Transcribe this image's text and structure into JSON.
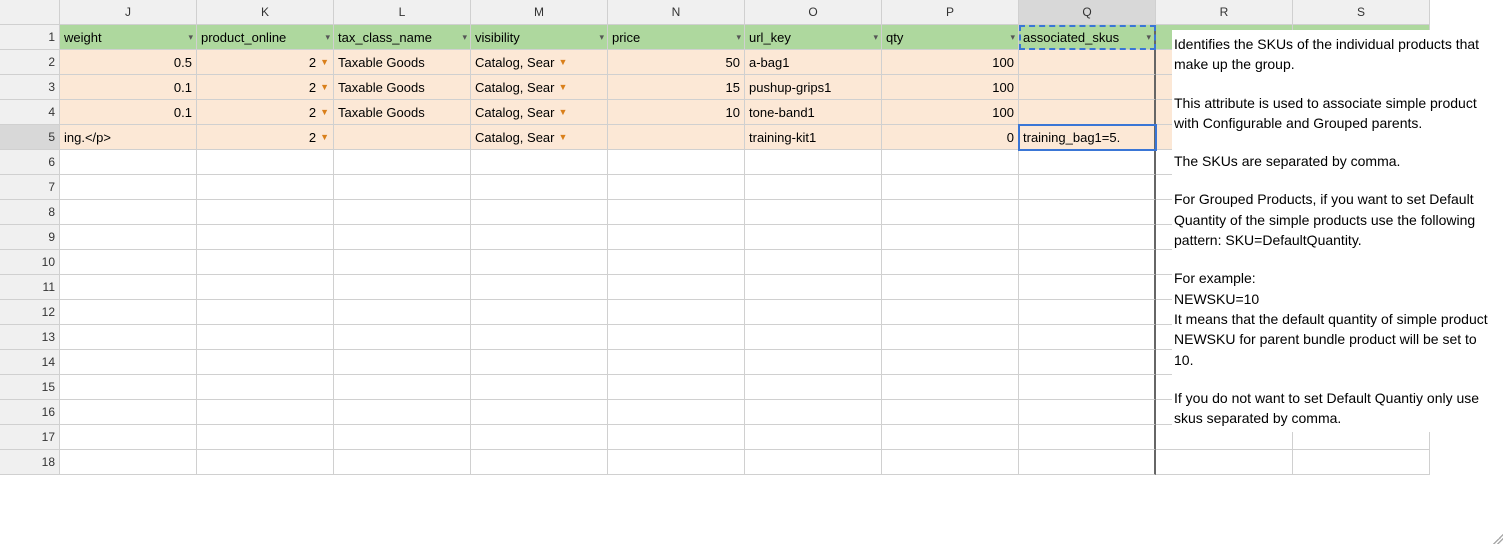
{
  "columns": [
    "J",
    "K",
    "L",
    "M",
    "N",
    "O",
    "P",
    "Q",
    "R",
    "S"
  ],
  "row_count": 18,
  "headers": {
    "J": "weight",
    "K": "product_online",
    "L": "tax_class_name",
    "M": "visibility",
    "N": "price",
    "O": "url_key",
    "P": "qty",
    "Q": "associated_skus",
    "R": "",
    "S": ""
  },
  "rows": [
    {
      "J": "0.5",
      "K": "2",
      "L": "Taxable Goods",
      "M": "Catalog, Sear",
      "N": "50",
      "O": "a-bag1",
      "P": "100",
      "Q": ""
    },
    {
      "J": "0.1",
      "K": "2",
      "L": "Taxable Goods",
      "M": "Catalog, Sear",
      "N": "15",
      "O": "pushup-grips1",
      "P": "100",
      "Q": ""
    },
    {
      "J": "0.1",
      "K": "2",
      "L": "Taxable Goods",
      "M": "Catalog, Sear",
      "N": "10",
      "O": "tone-band1",
      "P": "100",
      "Q": ""
    },
    {
      "J": "ing.</p>",
      "K": "2",
      "L": "",
      "M": "Catalog, Sear",
      "N": "",
      "O": "training-kit1",
      "P": "0",
      "Q": "training_bag1=5."
    }
  ],
  "dropdown_cols": [
    "K",
    "M"
  ],
  "numeric_cols": [
    "J",
    "K",
    "N",
    "P"
  ],
  "active_cell": "Q5",
  "dashed_cell": "Q1",
  "tooltip": {
    "p1": "Identifies the SKUs of the individual products that make up the group.",
    "p2": "This attribute is used to associate simple product with Configurable and Grouped parents.",
    "p3": "The SKUs are separated by comma.",
    "p4": "For Grouped Products, if you want to set Default Quantity of the simple products use the following pattern: SKU=DefaultQuantity.",
    "p5": "For example:\nNEWSKU=10\nIt means that the default quantity of simple product NEWSKU for parent bundle product will be set to 10.",
    "p6": "If you do not want to set Default Quantiy only use skus separated by comma."
  }
}
